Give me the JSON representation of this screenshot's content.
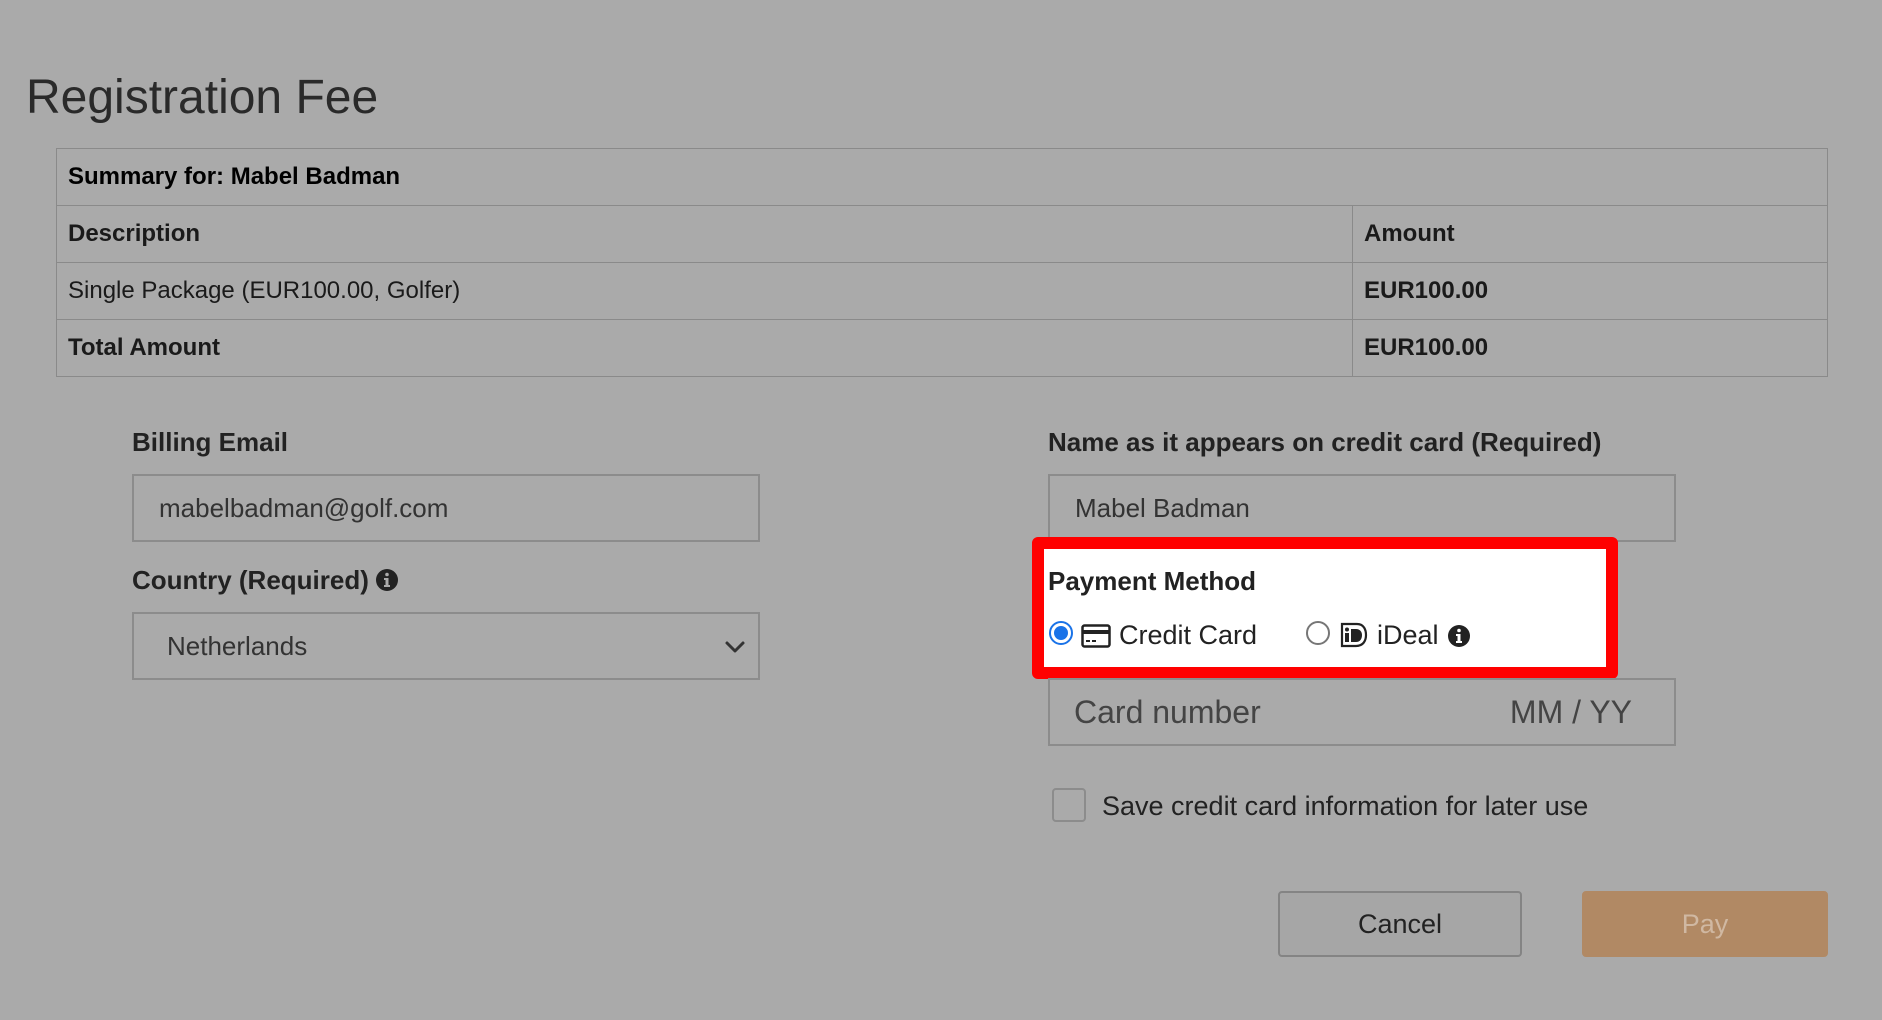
{
  "page": {
    "title": "Registration Fee"
  },
  "summary": {
    "header": "Summary for: Mabel Badman",
    "columns": [
      "Description",
      "Amount"
    ],
    "rows": [
      {
        "description": "Single Package (EUR100.00, Golfer)",
        "amount": "EUR100.00"
      }
    ],
    "total_label": "Total Amount",
    "total_amount": "EUR100.00"
  },
  "billing": {
    "email_label": "Billing Email",
    "email_value": "mabelbadman@golf.com",
    "country_label": "Country (Required)",
    "country_value": "Netherlands"
  },
  "card": {
    "name_label": "Name as it appears on credit card (Required)",
    "name_value": "Mabel Badman",
    "number_placeholder": "Card number",
    "expiry_placeholder": "MM / YY"
  },
  "payment_method": {
    "label": "Payment Method",
    "options": [
      {
        "label": "Credit Card",
        "icon": "credit-card-icon",
        "selected": true
      },
      {
        "label": "iDeal",
        "icon": "ideal-logo-icon",
        "selected": false
      }
    ],
    "highlight_color": "#ff0000"
  },
  "save_card": {
    "label": "Save credit card information for later use",
    "checked": false
  },
  "actions": {
    "cancel_label": "Cancel",
    "pay_label": "Pay",
    "pay_color": "#b18964"
  }
}
